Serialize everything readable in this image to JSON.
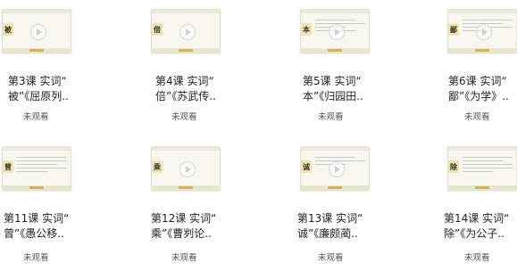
{
  "lessons": [
    {
      "title_line1": "第3课 实词“",
      "title_line2": "被”《屈原列..",
      "badge": "被",
      "status": "未观看"
    },
    {
      "title_line1": "第4课 实词“",
      "title_line2": "倍”《苏武传..",
      "badge": "倍",
      "status": "未观看"
    },
    {
      "title_line1": "第5课 实词“",
      "title_line2": "本”《归园田..",
      "badge": "本",
      "status": "未观看"
    },
    {
      "title_line1": "第6课 实词“",
      "title_line2": "鄙”《为学》..",
      "badge": "鄙",
      "status": "未观看"
    },
    {
      "title_line1": "第11课 实词“",
      "title_line2": "曾”《愚公移..",
      "badge": "曾",
      "status": "未观看"
    },
    {
      "title_line1": "第12课 实词“",
      "title_line2": "乘”《曹刿论..",
      "badge": "乘",
      "status": "未观看"
    },
    {
      "title_line1": "第13课 实词“",
      "title_line2": "诚”《廉颇蔺..",
      "badge": "诚",
      "status": "未观看"
    },
    {
      "title_line1": "第14课 实词“",
      "title_line2": "除”《为公子..",
      "badge": "除",
      "status": "未观看"
    }
  ]
}
